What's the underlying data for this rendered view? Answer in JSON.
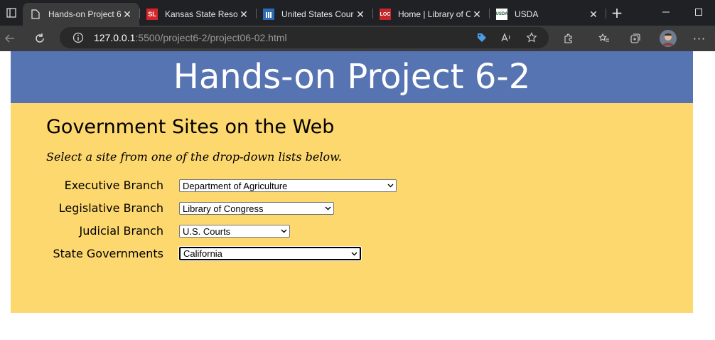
{
  "browser": {
    "tabs": [
      {
        "title": "Hands-on Project 6",
        "favicon": "page-icon",
        "active": true
      },
      {
        "title": "Kansas State Resou",
        "favicon": "SL",
        "favicon_color": "#d7262b"
      },
      {
        "title": "United States Cour",
        "favicon": "courts-icon",
        "favicon_color": "#2a6db5"
      },
      {
        "title": "Home | Library of C",
        "favicon": "LOC",
        "favicon_color": "#c4262c"
      },
      {
        "title": "USDA",
        "favicon": "USDA",
        "favicon_color": "#1f5f3a"
      }
    ],
    "url_host": "127.0.0.1",
    "url_rest": ":5500/project6-2/project06-02.html"
  },
  "page": {
    "header": "Hands-on Project 6-2",
    "heading": "Government Sites on the Web",
    "instructions": "Select a site from one of the drop-down lists below.",
    "rows": [
      {
        "label": "Executive Branch",
        "selected": "Department of Agriculture"
      },
      {
        "label": "Legislative Branch",
        "selected": "Library of Congress"
      },
      {
        "label": "Judicial Branch",
        "selected": "U.S. Courts"
      },
      {
        "label": "State Governments",
        "selected": "California"
      }
    ]
  },
  "colors": {
    "header_bg": "#5673b2",
    "content_bg": "#fdd86f"
  }
}
